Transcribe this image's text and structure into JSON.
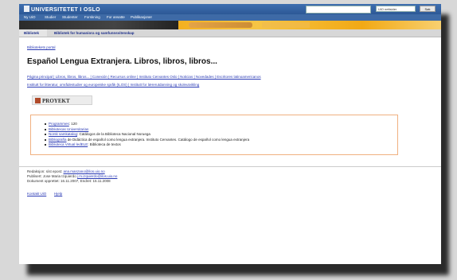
{
  "header": {
    "logo_text": "UNIVERSITETET I OSLO",
    "select_value": "UiO nettsider",
    "go_label": "Søk",
    "nav": [
      "Ny UiO",
      "Studier",
      "Studenter",
      "Forskning",
      "For ansatte",
      "Publikasjoner"
    ]
  },
  "breadcrumb": {
    "left": "Bibliotek",
    "right": "Bibliotek for humaniora og samfunnsvitenskap"
  },
  "back_link": "Bibliotekets portal",
  "page_title": "Español Lengua Extranjera. Libros, libros, libros...",
  "links_row": "Página principal | Libros, libros, libros... | Conexión | Recursos online | Instituto Cervantes Oslo | Noticias | Novedades | Escritores latinoamericanos",
  "links_row2": "Institutt for litteratur, områdestudier og europeiske språk (ILOS) | Institutt for lærerutdanning og skoleutvikling",
  "proyekt_label": "PROYEKT",
  "resources": [
    {
      "link": "Programmes",
      "rest": ": 120"
    },
    {
      "link": "Bibliotecas Universitarias",
      "rest": ""
    },
    {
      "link": "Norsk samkatalog",
      "rest": ": Catálogos de la Biblioteca Nacional Noruega"
    },
    {
      "link": "Bibliografía",
      "rest": " de Didáctica de español como lengua extranjera. Instituto Cervantes. Catálogo de español como lengua extranjera"
    },
    {
      "link": "Biblioteca Virtual ledELE",
      "rest": ": Biblioteca de textos"
    }
  ],
  "footer": {
    "line1": "Redaksjon: síst epost:",
    "line1_link": "ana.manzano@ilos.uio.no",
    "line2": "Publisert: Jose Maria Izquierdo",
    "line2_link": "j.m.izquierdo@ilos.uio.no",
    "line3": "Dokument opprettet: 16.11.2007, Endret: 15.11.2008",
    "bottom_links": [
      "Kontakt UiO",
      "Hjelp"
    ]
  }
}
